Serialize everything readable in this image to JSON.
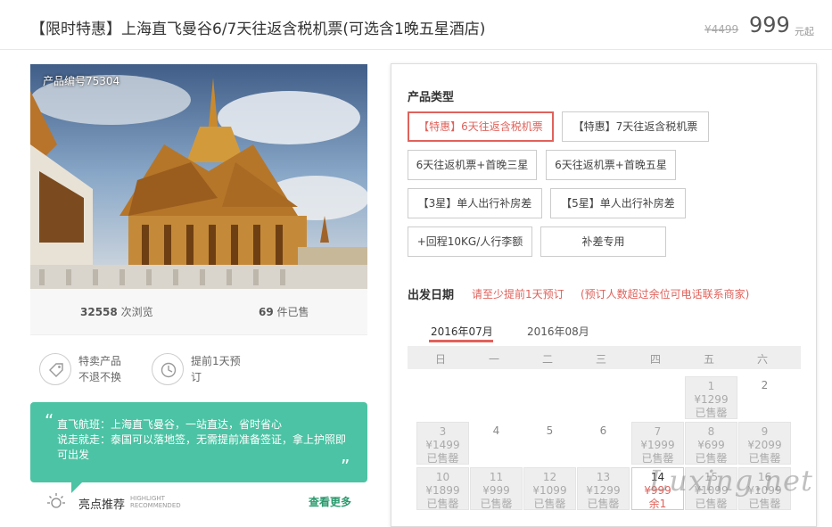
{
  "header": {
    "title": "【限时特惠】上海直飞曼谷6/7天往返含税机票(可选含1晚五星酒店)",
    "original_price": "¥4499",
    "price": "999",
    "price_suffix": "元起"
  },
  "product": {
    "number_label": "产品编号75304",
    "views_count": "32558",
    "views_label": "次浏览",
    "sold_count": "69",
    "sold_label": "件已售"
  },
  "features": [
    {
      "icon": "tag-icon",
      "line1": "特卖产品",
      "line2": "不退不换"
    },
    {
      "icon": "clock-icon",
      "line1": "提前1天预",
      "line2": "订"
    }
  ],
  "quote": {
    "open": "“",
    "text": "直飞航班：上海直飞曼谷，一站直达，省时省心\n说走就走：泰国可以落地签，无需提前准备签证，拿上护照即可出发",
    "close": "”"
  },
  "highlight": {
    "title": "亮点推荐",
    "sub1": "HIGHLIGHT",
    "sub2": "RECOMMENDED",
    "more": "查看更多"
  },
  "booking": {
    "product_type_label": "产品类型",
    "options": [
      {
        "label": "【特惠】6天往返含税机票",
        "selected": true
      },
      {
        "label": "【特惠】7天往返含税机票",
        "selected": false
      },
      {
        "label": "6天往返机票+首晚三星",
        "selected": false
      },
      {
        "label": "6天往返机票+首晚五星",
        "selected": false
      },
      {
        "label": "【3星】单人出行补房差",
        "selected": false
      },
      {
        "label": "【5星】单人出行补房差",
        "selected": false
      },
      {
        "label": "+回程10KG/人行李额",
        "selected": false
      },
      {
        "label": "补差专用",
        "selected": false
      }
    ],
    "date_label": "出发日期",
    "note1": "请至少提前1天预订",
    "note2": "(预订人数超过余位可电话联系商家)",
    "months": [
      "2016年07月",
      "2016年08月"
    ],
    "active_month": 0,
    "weekdays": [
      "日",
      "一",
      "二",
      "三",
      "四",
      "五",
      "六"
    ]
  },
  "calendar": [
    {
      "day": "1",
      "price": "¥1299",
      "status": "已售罄",
      "type": "past"
    },
    {
      "day": "2",
      "price": "",
      "status": "",
      "type": "empty"
    },
    {
      "day": "3",
      "price": "¥1499",
      "status": "已售罄",
      "type": "past"
    },
    {
      "day": "4",
      "price": "",
      "status": "",
      "type": "empty"
    },
    {
      "day": "5",
      "price": "",
      "status": "",
      "type": "empty"
    },
    {
      "day": "6",
      "price": "",
      "status": "",
      "type": "empty"
    },
    {
      "day": "7",
      "price": "¥1999",
      "status": "已售罄",
      "type": "past"
    },
    {
      "day": "8",
      "price": "¥699",
      "status": "已售罄",
      "type": "past"
    },
    {
      "day": "9",
      "price": "¥2099",
      "status": "已售罄",
      "type": "past"
    },
    {
      "day": "10",
      "price": "¥1899",
      "status": "已售罄",
      "type": "past"
    },
    {
      "day": "11",
      "price": "¥999",
      "status": "已售罄",
      "type": "past"
    },
    {
      "day": "12",
      "price": "¥1099",
      "status": "已售罄",
      "type": "past"
    },
    {
      "day": "13",
      "price": "¥1299",
      "status": "已售罄",
      "type": "past"
    },
    {
      "day": "14",
      "price": "¥999",
      "status": "余1",
      "type": "cur"
    },
    {
      "day": "15",
      "price": "¥1099",
      "status": "已售罄",
      "type": "past"
    },
    {
      "day": "16",
      "price": "¥1099",
      "status": "已售罄",
      "type": "past"
    }
  ],
  "watermark": "Luxing.net"
}
